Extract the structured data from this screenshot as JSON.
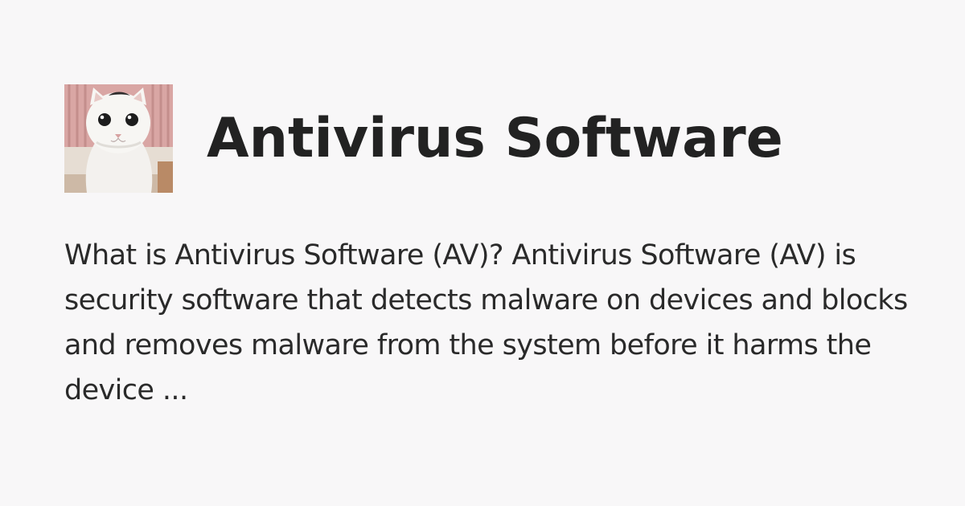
{
  "card": {
    "title": "Antivirus Software",
    "description": "What is Antivirus Software (AV)? Antivirus Software (AV) is security software that detects malware on devices and blocks and removes malware from the system before it harms the device ...",
    "avatar": {
      "depicts": "white cat photo",
      "icon": "cat-avatar-icon"
    }
  },
  "colors": {
    "background": "#f8f7f8",
    "title": "#222222",
    "text": "#2a2a2a"
  }
}
